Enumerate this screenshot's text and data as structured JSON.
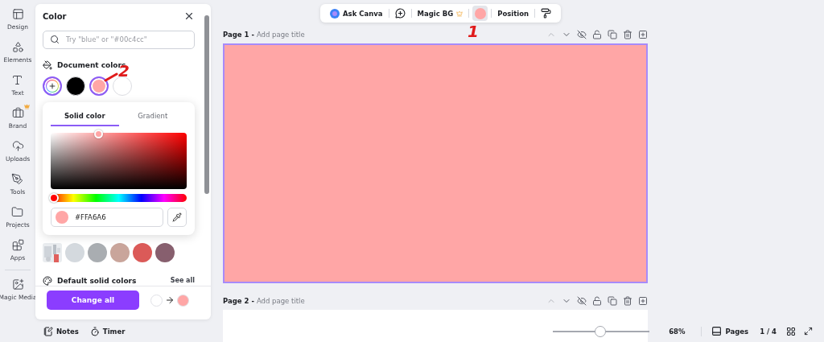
{
  "rail": {
    "items": [
      {
        "label": "Design",
        "premium": false
      },
      {
        "label": "Elements",
        "premium": false
      },
      {
        "label": "Text",
        "premium": false
      },
      {
        "label": "Brand",
        "premium": true
      },
      {
        "label": "Uploads",
        "premium": false
      },
      {
        "label": "Tools",
        "premium": false
      },
      {
        "label": "Projects",
        "premium": false
      },
      {
        "label": "Apps",
        "premium": false
      },
      {
        "label": "Magic Media",
        "premium": false
      }
    ]
  },
  "panel": {
    "title": "Color",
    "search": {
      "placeholder": "Try \"blue\" or \"#00c4cc\""
    },
    "document_colors": {
      "title": "Document colors",
      "swatches": [
        {
          "kind": "add",
          "selected": true
        },
        {
          "kind": "color",
          "color": "#000000",
          "selected": false
        },
        {
          "kind": "color",
          "color": "#ffa6a6",
          "selected": true
        },
        {
          "kind": "color",
          "color": "#ffffff",
          "selected": false
        }
      ]
    },
    "picker": {
      "tabs": [
        {
          "label": "Solid color",
          "selected": true
        },
        {
          "label": "Gradient",
          "selected": false
        }
      ],
      "hue": {
        "level": 0
      },
      "hex": {
        "value": "#FFA6A6",
        "color": "#ffa6a6"
      }
    },
    "photo_colors": {
      "swatches": [
        {
          "kind": "picture"
        },
        {
          "kind": "color",
          "color": "#d4d9de"
        },
        {
          "kind": "color",
          "color": "#a9adb1"
        },
        {
          "kind": "color",
          "color": "#c9a59b"
        },
        {
          "kind": "color",
          "color": "#db5a58"
        },
        {
          "kind": "color",
          "color": "#875f6e"
        }
      ]
    },
    "default_colors": {
      "title": "Default solid colors",
      "link": "See all"
    },
    "footer": {
      "button": "Change all",
      "swatches": [
        {
          "color": "#ffffff"
        },
        {
          "color": "#ffa6a6"
        }
      ]
    }
  },
  "toolbar": {
    "items": [
      {
        "kind": "ask",
        "label": "Ask Canva"
      },
      {
        "kind": "comment"
      },
      {
        "kind": "magic",
        "label": "Magic BG",
        "premium": true
      },
      {
        "kind": "swatch",
        "color": "#ffa6a6",
        "selected": true
      },
      {
        "kind": "text",
        "label": "Position"
      },
      {
        "kind": "roller"
      }
    ]
  },
  "pages": [
    {
      "label": "Page 1 -",
      "placeholder": "Add page title",
      "color": "#ffa6a6",
      "selected": true
    },
    {
      "label": "Page 2 -",
      "placeholder": "Add page title",
      "color": "#ffffff",
      "selected": false
    }
  ],
  "bottom_bar": {
    "notes": "Notes",
    "timer": "Timer",
    "zoom": {
      "level": 0.49,
      "reading": "68%"
    },
    "pages": "Pages",
    "page_count": "1 / 4"
  },
  "annotations": [
    {
      "text": "1"
    },
    {
      "text": "2"
    }
  ]
}
